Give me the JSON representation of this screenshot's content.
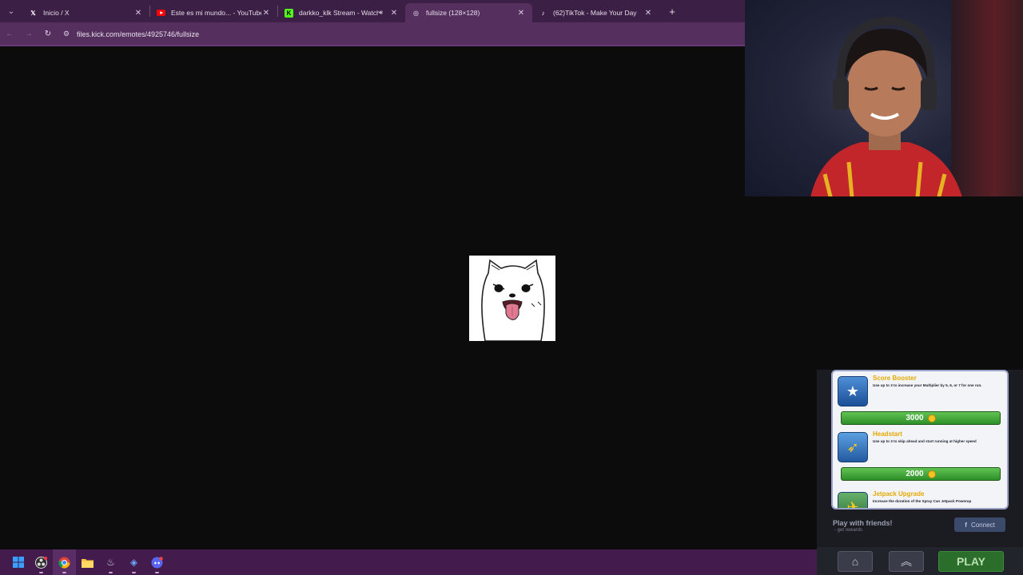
{
  "browser": {
    "tabs": [
      {
        "title": "Inicio / X",
        "favicon": "x-logo-icon",
        "audio": false,
        "active": false
      },
      {
        "title": "Este es mi mundo... - YouTube",
        "favicon": "youtube-icon",
        "audio": false,
        "active": false
      },
      {
        "title": "darkko_klk Stream - Watch",
        "favicon": "kick-icon",
        "audio": true,
        "active": false
      },
      {
        "title": "fullsize (128×128)",
        "favicon": "globe-icon",
        "audio": false,
        "active": true
      },
      {
        "title": "(62)TikTok - Make Your Day",
        "favicon": "tiktok-icon",
        "audio": false,
        "active": false
      }
    ],
    "url": "files.kick.com/emotes/4925746/fullsize"
  },
  "game": {
    "items": [
      {
        "name": "Score Booster",
        "description": "Use up to 3 to increase your Multiplier by 5, 6, or 7 for one run.",
        "price": "3000",
        "icon": "star-icon"
      },
      {
        "name": "Headstart",
        "description": "Use up to 3 to skip ahead and start running at higher speed",
        "price": "2000",
        "icon": "rocket-icon"
      },
      {
        "name": "Jetpack Upgrade",
        "description": "Increase the duration of the Spray Can Jetpack Powerup",
        "icon": "jetpack-icon"
      }
    ],
    "social_text": "Play with friends!",
    "social_sub": "- get rewards",
    "connect_label": "Connect",
    "play_label": "PLAY"
  },
  "taskbar": {
    "apps": [
      "windows-start-icon",
      "obs-icon",
      "chrome-icon",
      "file-explorer-icon",
      "steam-icon",
      "app-diamond-icon",
      "discord-icon"
    ]
  },
  "colors": {
    "tabbar": "#3b1f45",
    "toolbar": "#55305f",
    "taskbar": "#431b4d",
    "page_bg": "#0c0c0c",
    "buy_button": "#3fa53a",
    "item_name": "#e4a900"
  }
}
